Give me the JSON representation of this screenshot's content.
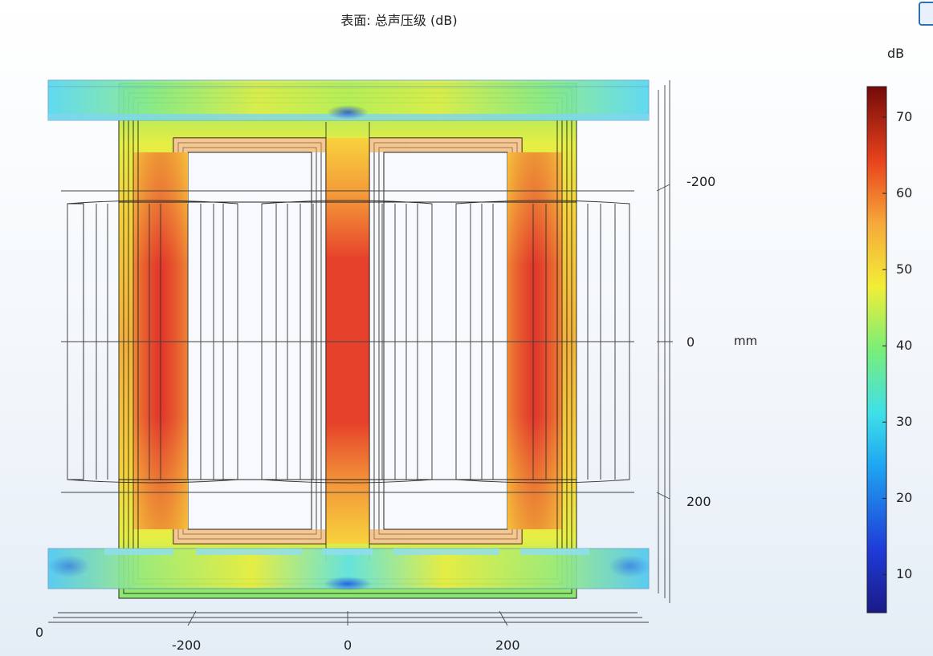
{
  "title": "表面: 总声压级 (dB)",
  "unit_vertical": "mm",
  "colorbar": {
    "unit": "dB",
    "min": 5,
    "max": 74,
    "ticks": [
      "10",
      "20",
      "30",
      "40",
      "50",
      "60",
      "70"
    ]
  },
  "axes": {
    "vertical_ticks": [
      "-200",
      "0",
      "200"
    ],
    "horizontal_ticks": [
      "-200",
      "0",
      "200"
    ],
    "origin_label": "0"
  },
  "colors": {
    "hot": "#d8242a",
    "warm": "#f7e23a",
    "cool": "#3fd8f0",
    "lines": "#222222"
  }
}
